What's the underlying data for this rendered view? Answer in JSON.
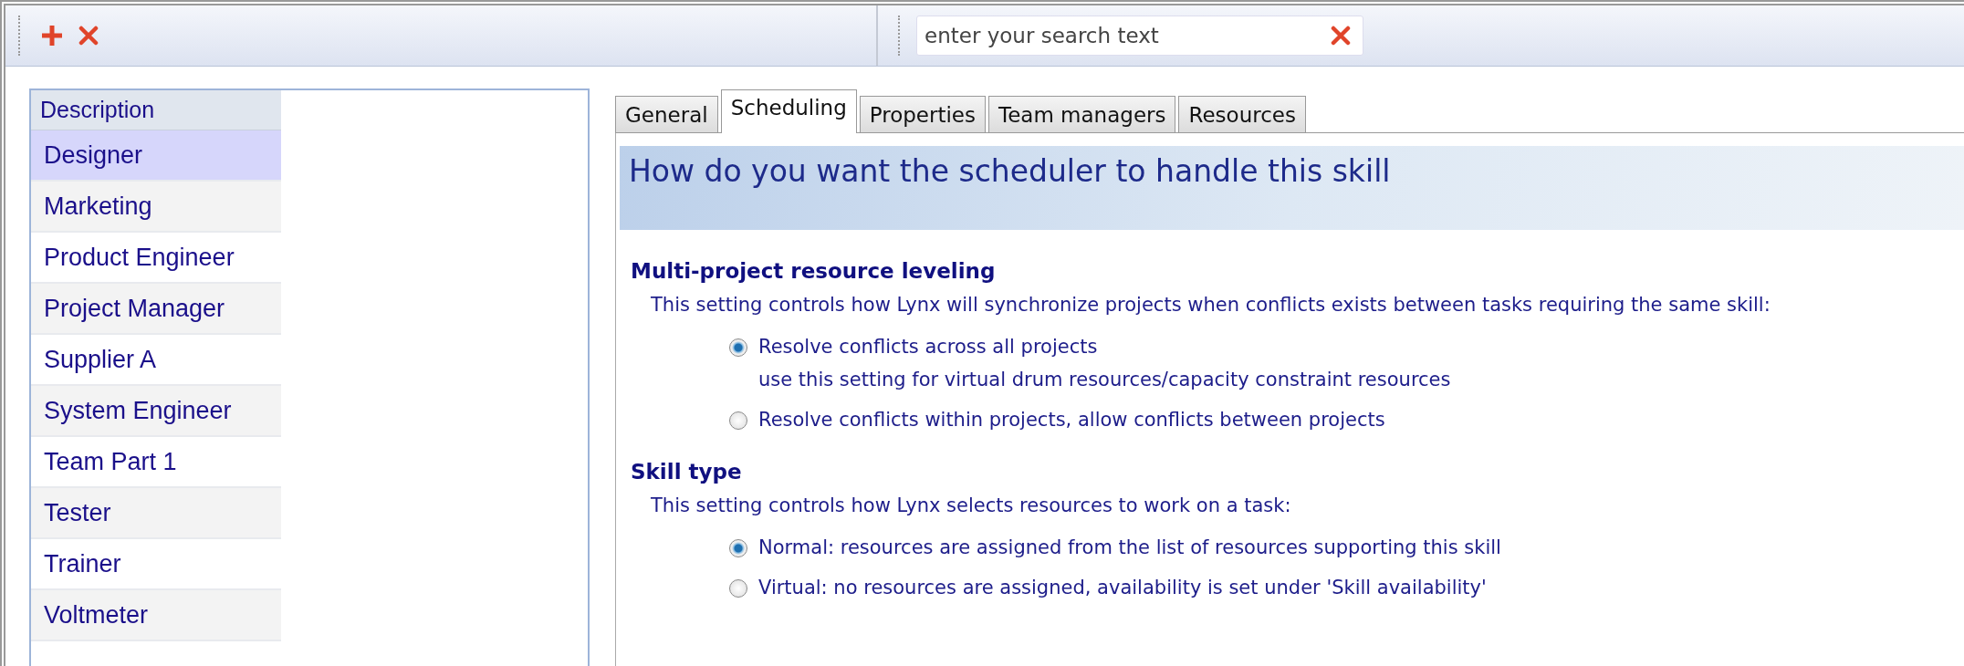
{
  "toolbar": {
    "search": {
      "placeholder": "enter your search text"
    }
  },
  "list": {
    "column": "Description",
    "items": [
      {
        "label": "Designer",
        "selected": true
      },
      {
        "label": "Marketing",
        "selected": false
      },
      {
        "label": "Product Engineer",
        "selected": false
      },
      {
        "label": "Project Manager",
        "selected": false
      },
      {
        "label": "Supplier A",
        "selected": false
      },
      {
        "label": "System Engineer",
        "selected": false
      },
      {
        "label": "Team Part 1",
        "selected": false
      },
      {
        "label": "Tester",
        "selected": false
      },
      {
        "label": "Trainer",
        "selected": false
      },
      {
        "label": "Voltmeter",
        "selected": false
      }
    ]
  },
  "tabs": [
    {
      "label": "General",
      "selected": false
    },
    {
      "label": "Scheduling",
      "selected": true
    },
    {
      "label": "Properties",
      "selected": false
    },
    {
      "label": "Team managers",
      "selected": false
    },
    {
      "label": "Resources",
      "selected": false
    }
  ],
  "panel": {
    "title": "How do you want the scheduler to handle this skill",
    "sections": [
      {
        "heading": "Multi-project resource leveling",
        "description": "This setting controls how Lynx will synchronize projects when conflicts exists between tasks requiring the same skill:",
        "options": [
          {
            "label": "Resolve conflicts across all projects",
            "note": "use this setting for virtual drum resources/capacity constraint resources",
            "selected": true
          },
          {
            "label": "Resolve conflicts within projects, allow conflicts between projects",
            "selected": false
          }
        ]
      },
      {
        "heading": "Skill type",
        "description": "This setting controls how Lynx selects resources to work on a task:",
        "options": [
          {
            "label": "Normal: resources are assigned from the list of resources supporting this skill",
            "selected": true
          },
          {
            "label": "Virtual: no resources are assigned, availability is set under 'Skill availability'",
            "selected": false
          }
        ]
      }
    ]
  }
}
